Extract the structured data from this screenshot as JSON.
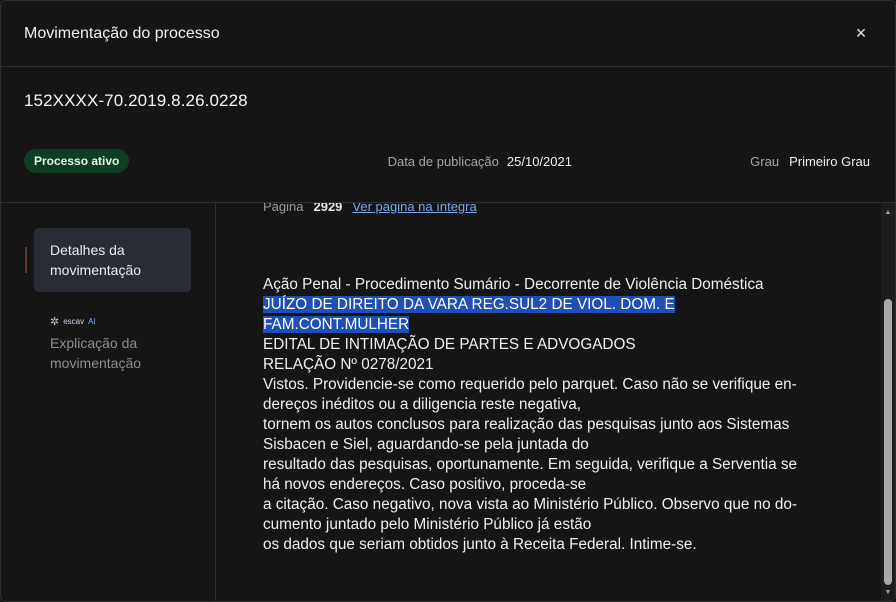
{
  "header": {
    "title": "Movimentação do processo",
    "close_symbol": "×"
  },
  "process": {
    "number": "152XXXX-70.2019.8.26.0228",
    "status_badge": "Processo ativo",
    "publication_label": "Data de publicação",
    "publication_date": "25/10/2021",
    "grau_label": "Grau",
    "grau_value": "Primeiro Grau"
  },
  "sidebar": {
    "active_item": {
      "line1": "Detalhes da",
      "line2": "movimentação"
    },
    "brand": {
      "name": "escav",
      "suffix": "AI"
    },
    "item2": {
      "line1": "Explicação da",
      "line2": "movimentação"
    }
  },
  "content": {
    "page_label": "Página",
    "page_number": "2929",
    "page_link": "Ver página na íntegra",
    "lines": [
      {
        "text": "Ação Penal - Procedimento Sumário - Decorrente de Violência Doméstica",
        "highlighted": false
      },
      {
        "text": "JUÍZO DE DIREITO DA VARA REG.SUL2 DE VIOL. DOM. E",
        "highlighted": true
      },
      {
        "text": "FAM.CONT.MULHER",
        "highlighted": true
      },
      {
        "text": "EDITAL DE INTIMAÇÃO DE PARTES E ADVOGADOS",
        "highlighted": false
      },
      {
        "text": "RELAÇÃO Nº 0278/2021",
        "highlighted": false
      },
      {
        "text": "Vistos. Providencie-se como requerido pelo parquet. Caso não se verifique en-",
        "highlighted": false
      },
      {
        "text": "dereços inéditos ou a diligencia reste negativa,",
        "highlighted": false
      },
      {
        "text": "tornem os autos conclusos para realização das pesquisas junto aos Sistemas",
        "highlighted": false
      },
      {
        "text": "Sisbacen e Siel, aguardando-se pela juntada do",
        "highlighted": false
      },
      {
        "text": "resultado das pesquisas, oportunamente. Em seguida, verifique a Serventia se",
        "highlighted": false
      },
      {
        "text": "há novos endereços. Caso positivo, proceda-se",
        "highlighted": false
      },
      {
        "text": "a citação. Caso negativo, nova vista ao Ministério Público. Observo que no do-",
        "highlighted": false
      },
      {
        "text": "cumento juntado pelo Ministério Público já estão",
        "highlighted": false
      },
      {
        "text": "os dados que seriam obtidos junto à Receita Federal. Intime-se.",
        "highlighted": false
      }
    ]
  },
  "colors": {
    "badge_bg": "#0d3d23",
    "highlight": "#1e4fb5",
    "link": "#7ea7e6",
    "active_item_bg": "#282d35"
  },
  "icons": {
    "close": "close-icon",
    "brand": "escavai-logo-icon"
  }
}
